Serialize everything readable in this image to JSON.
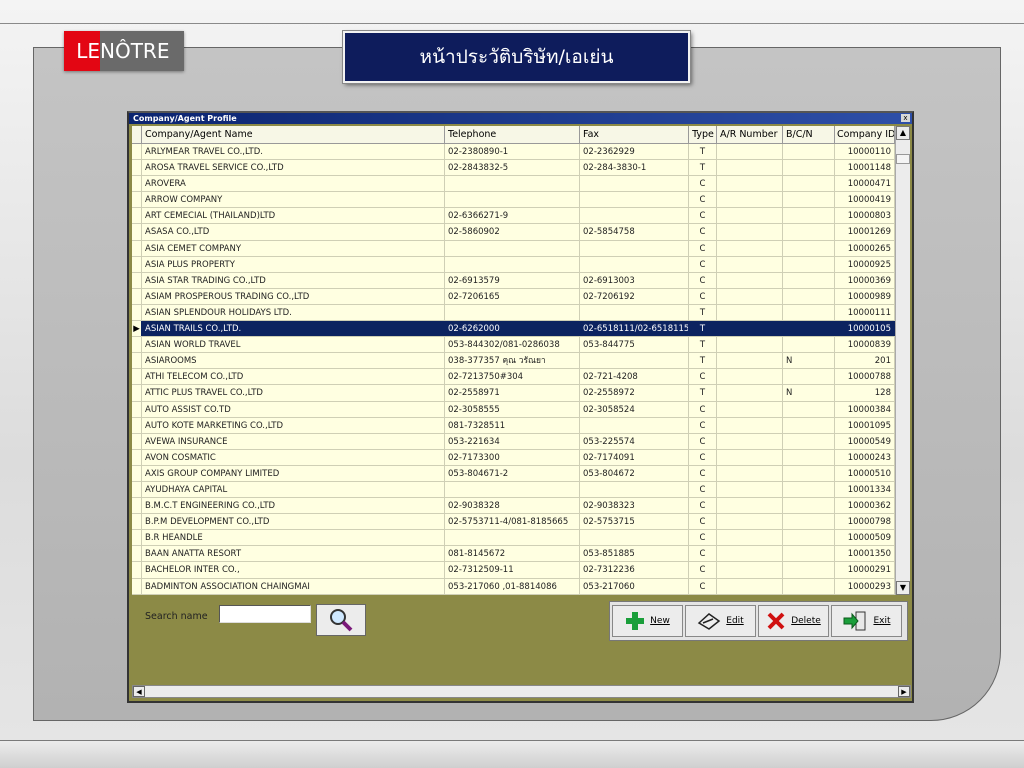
{
  "logo": {
    "left": "LE",
    "right": "NÔTRE"
  },
  "page_title": "หน้าประวัติบริษัท/เอเย่น",
  "window": {
    "title": "Company/Agent Profile",
    "close": "x"
  },
  "table": {
    "columns": [
      "Company/Agent Name",
      "Telephone",
      "Fax",
      "Type",
      "A/R Number",
      "B/C/N",
      "Company ID"
    ],
    "rows": [
      {
        "name": "ARLYMEAR TRAVEL CO.,LTD.",
        "tel": "02-2380890-1",
        "fax": "02-2362929",
        "type": "T",
        "ar": "",
        "bcn": "",
        "id": "10000110"
      },
      {
        "name": "AROSA TRAVEL SERVICE CO.,LTD",
        "tel": "02-2843832-5",
        "fax": "02-284-3830-1",
        "type": "T",
        "ar": "",
        "bcn": "",
        "id": "10001148"
      },
      {
        "name": "AROVERA",
        "tel": "",
        "fax": "",
        "type": "C",
        "ar": "",
        "bcn": "",
        "id": "10000471"
      },
      {
        "name": "ARROW COMPANY",
        "tel": "",
        "fax": "",
        "type": "C",
        "ar": "",
        "bcn": "",
        "id": "10000419"
      },
      {
        "name": "ART CEMECIAL (THAILAND)LTD",
        "tel": "02-6366271-9",
        "fax": "",
        "type": "C",
        "ar": "",
        "bcn": "",
        "id": "10000803"
      },
      {
        "name": "ASASA CO.,LTD",
        "tel": "02-5860902",
        "fax": "02-5854758",
        "type": "C",
        "ar": "",
        "bcn": "",
        "id": "10001269"
      },
      {
        "name": "ASIA CEMET COMPANY",
        "tel": "",
        "fax": "",
        "type": "C",
        "ar": "",
        "bcn": "",
        "id": "10000265"
      },
      {
        "name": "ASIA PLUS PROPERTY",
        "tel": "",
        "fax": "",
        "type": "C",
        "ar": "",
        "bcn": "",
        "id": "10000925"
      },
      {
        "name": "ASIA STAR TRADING CO.,LTD",
        "tel": "02-6913579",
        "fax": "02-6913003",
        "type": "C",
        "ar": "",
        "bcn": "",
        "id": "10000369"
      },
      {
        "name": "ASIAM PROSPEROUS TRADING CO.,LTD",
        "tel": "02-7206165",
        "fax": "02-7206192",
        "type": "C",
        "ar": "",
        "bcn": "",
        "id": "10000989"
      },
      {
        "name": "ASIAN SPLENDOUR HOLIDAYS LTD.",
        "tel": "",
        "fax": "",
        "type": "T",
        "ar": "",
        "bcn": "",
        "id": "10000111"
      },
      {
        "name": "ASIAN TRAILS CO.,LTD.",
        "tel": "02-6262000",
        "fax": "02-6518111/02-6518115",
        "type": "T",
        "ar": "",
        "bcn": "",
        "id": "10000105",
        "selected": true
      },
      {
        "name": "ASIAN WORLD TRAVEL",
        "tel": "053-844302/081-0286038",
        "fax": "053-844775",
        "type": "T",
        "ar": "",
        "bcn": "",
        "id": "10000839"
      },
      {
        "name": "ASIAROOMS",
        "tel": "038-377357 คุณ วรัณยา",
        "fax": "",
        "type": "T",
        "ar": "",
        "bcn": "N",
        "id": "201"
      },
      {
        "name": "ATHI TELECOM CO.,LTD",
        "tel": "02-7213750#304",
        "fax": "02-721-4208",
        "type": "C",
        "ar": "",
        "bcn": "",
        "id": "10000788"
      },
      {
        "name": "ATTIC PLUS TRAVEL CO.,LTD",
        "tel": "02-2558971",
        "fax": "02-2558972",
        "type": "T",
        "ar": "",
        "bcn": "N",
        "id": "128"
      },
      {
        "name": "AUTO ASSIST CO.TD",
        "tel": "02-3058555",
        "fax": "02-3058524",
        "type": "C",
        "ar": "",
        "bcn": "",
        "id": "10000384"
      },
      {
        "name": "AUTO KOTE MARKETING CO.,LTD",
        "tel": "081-7328511",
        "fax": "",
        "type": "C",
        "ar": "",
        "bcn": "",
        "id": "10001095"
      },
      {
        "name": "AVEWA INSURANCE",
        "tel": "053-221634",
        "fax": "053-225574",
        "type": "C",
        "ar": "",
        "bcn": "",
        "id": "10000549"
      },
      {
        "name": "AVON COSMATIC",
        "tel": "02-7173300",
        "fax": "02-7174091",
        "type": "C",
        "ar": "",
        "bcn": "",
        "id": "10000243"
      },
      {
        "name": "AXIS GROUP COMPANY LIMITED",
        "tel": "053-804671-2",
        "fax": "053-804672",
        "type": "C",
        "ar": "",
        "bcn": "",
        "id": "10000510"
      },
      {
        "name": "AYUDHAYA CAPITAL",
        "tel": "",
        "fax": "",
        "type": "C",
        "ar": "",
        "bcn": "",
        "id": "10001334"
      },
      {
        "name": "B.M.C.T ENGINEERING CO.,LTD",
        "tel": "02-9038328",
        "fax": "02-9038323",
        "type": "C",
        "ar": "",
        "bcn": "",
        "id": "10000362"
      },
      {
        "name": "B.P.M DEVELOPMENT CO.,LTD",
        "tel": "02-5753711-4/081-8185665",
        "fax": "02-5753715",
        "type": "C",
        "ar": "",
        "bcn": "",
        "id": "10000798"
      },
      {
        "name": "B.R HEANDLE",
        "tel": "",
        "fax": "",
        "type": "C",
        "ar": "",
        "bcn": "",
        "id": "10000509"
      },
      {
        "name": "BAAN ANATTA RESORT",
        "tel": "081-8145672",
        "fax": "053-851885",
        "type": "C",
        "ar": "",
        "bcn": "",
        "id": "10001350"
      },
      {
        "name": "BACHELOR INTER CO.,",
        "tel": "02-7312509-11",
        "fax": "02-7312236",
        "type": "C",
        "ar": "",
        "bcn": "",
        "id": "10000291"
      },
      {
        "name": "BADMINTON ASSOCIATION CHAINGMAI",
        "tel": "053-217060 ,01-8814086",
        "fax": "053-217060",
        "type": "C",
        "ar": "",
        "bcn": "",
        "id": "10000293"
      }
    ]
  },
  "search": {
    "label": "Search name",
    "value": ""
  },
  "buttons": {
    "new": "New",
    "edit": "Edit",
    "delete": "Delete",
    "exit": "Exit"
  },
  "colors": {
    "title_bg": "#0e1c5c",
    "grid_bg": "#ffffe1",
    "selected_row": "#0c2360",
    "panel_bg": "#8c8a46",
    "logo_red": "#e30613"
  }
}
